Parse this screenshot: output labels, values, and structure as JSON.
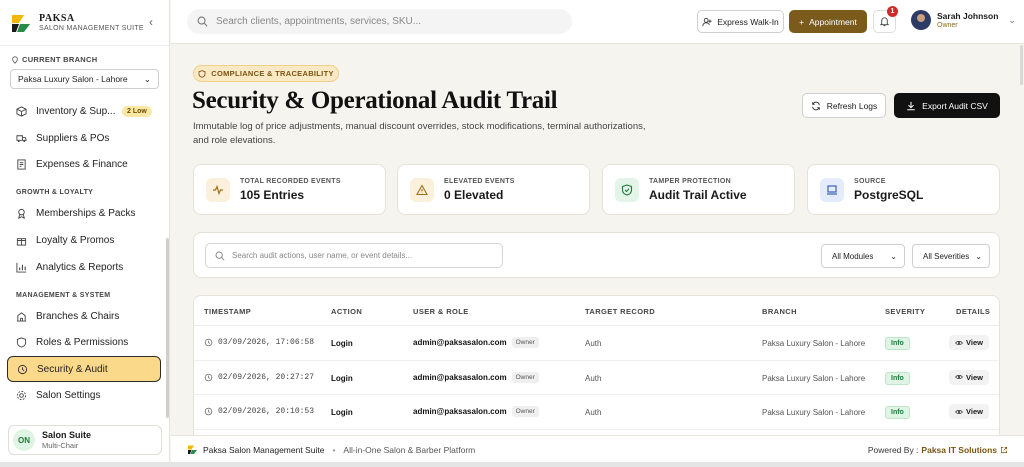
{
  "brand": {
    "name": "PAKSA",
    "subtitle": "SALON MANAGEMENT SUITE",
    "colors": {
      "gold": "#f2b705",
      "dark": "#1a1a1a",
      "accent": "#7a5b1c"
    }
  },
  "branch": {
    "label": "CURRENT BRANCH",
    "selected": "Paksa Luxury Salon - Lahore"
  },
  "nav": {
    "top_items": [
      {
        "label": "Inventory & Sup...",
        "icon": "box-icon",
        "badge": "2 Low"
      },
      {
        "label": "Suppliers & POs",
        "icon": "truck-icon"
      },
      {
        "label": "Expenses & Finance",
        "icon": "receipt-icon"
      }
    ],
    "section_growth": "GROWTH & LOYALTY",
    "growth_items": [
      {
        "label": "Memberships & Packs",
        "icon": "ribbon-icon"
      },
      {
        "label": "Loyalty & Promos",
        "icon": "gift-icon"
      },
      {
        "label": "Analytics & Reports",
        "icon": "chart-icon"
      }
    ],
    "section_mgmt": "MANAGEMENT & SYSTEM",
    "mgmt_items": [
      {
        "label": "Branches & Chairs",
        "icon": "building-icon"
      },
      {
        "label": "Roles & Permissions",
        "icon": "shield-icon"
      },
      {
        "label": "Security & Audit",
        "icon": "history-icon",
        "active": true
      },
      {
        "label": "Salon Settings",
        "icon": "gear-icon"
      }
    ]
  },
  "suite": {
    "status": "ON",
    "title": "Salon Suite",
    "subtitle": "Multi-Chair"
  },
  "topbar": {
    "search_placeholder": "Search clients, appointments, services, SKU...",
    "walkin_label": "Express Walk-In",
    "appointment_label": "Appointment",
    "notification_count": "1",
    "user_name": "Sarah Johnson",
    "user_role": "Owner"
  },
  "page": {
    "badge": "COMPLIANCE & TRACEABILITY",
    "title": "Security & Operational Audit Trail",
    "description": "Immutable log of price adjustments, manual discount overrides, stock modifications, terminal authorizations, and role elevations.",
    "refresh_label": "Refresh Logs",
    "export_label": "Export Audit CSV"
  },
  "stats": [
    {
      "label": "TOTAL RECORDED EVENTS",
      "value": "105 Entries",
      "icon": "activity-icon",
      "bg": "#fbf0dc",
      "fg": "#a3701a"
    },
    {
      "label": "ELEVATED EVENTS",
      "value": "0 Elevated",
      "icon": "warning-icon",
      "bg": "#fbf0dc",
      "fg": "#a3701a"
    },
    {
      "label": "TAMPER PROTECTION",
      "value": "Audit Trail Active",
      "icon": "shield-check-icon",
      "bg": "#e3f4e8",
      "fg": "#1e7a3a"
    },
    {
      "label": "SOURCE",
      "value": "PostgreSQL",
      "icon": "database-icon",
      "bg": "#e4ecfb",
      "fg": "#2a55b0"
    }
  ],
  "filters": {
    "search_placeholder": "Search audit actions, user name, or event details...",
    "module": "All Modules",
    "severity": "All Severities"
  },
  "table": {
    "headers": [
      "TIMESTAMP",
      "ACTION",
      "USER & ROLE",
      "TARGET RECORD",
      "BRANCH",
      "SEVERITY",
      "DETAILS"
    ],
    "rows": [
      {
        "timestamp": "03/09/2026, 17:06:58",
        "action": "Login",
        "user": "admin@paksasalon.com",
        "role": "Owner",
        "target": "Auth",
        "branch": "Paksa Luxury Salon - Lahore",
        "severity": "Info",
        "details": "View"
      },
      {
        "timestamp": "02/09/2026, 20:27:27",
        "action": "Login",
        "user": "admin@paksasalon.com",
        "role": "Owner",
        "target": "Auth",
        "branch": "Paksa Luxury Salon - Lahore",
        "severity": "Info",
        "details": "View"
      },
      {
        "timestamp": "02/09/2026, 20:10:53",
        "action": "Login",
        "user": "admin@paksasalon.com",
        "role": "Owner",
        "target": "Auth",
        "branch": "Paksa Luxury Salon - Lahore",
        "severity": "Info",
        "details": "View"
      }
    ]
  },
  "footer": {
    "app_name": "Paksa Salon Management Suite",
    "separator": "•",
    "tagline": "All-in-One Salon & Barber Platform",
    "powered_label": "Powered By :",
    "company": "Paksa IT Solutions"
  }
}
